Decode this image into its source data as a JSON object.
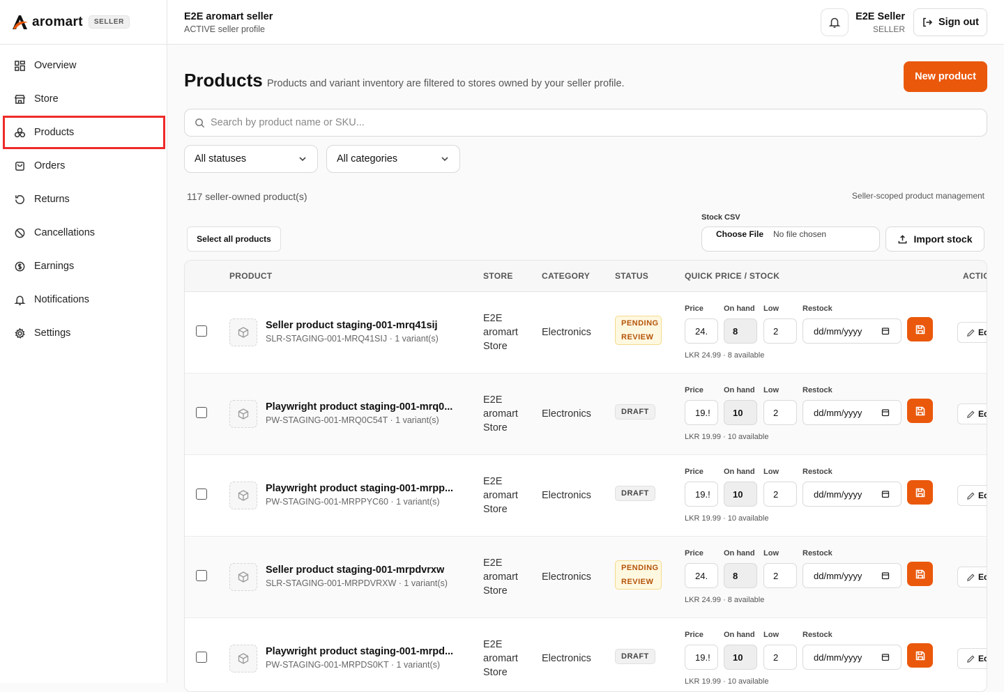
{
  "brand": {
    "name": "aromart",
    "badge": "SELLER",
    "accent": "#ea580c"
  },
  "sidebar": {
    "items": [
      {
        "label": "Overview",
        "icon": "grid-icon"
      },
      {
        "label": "Store",
        "icon": "store-icon"
      },
      {
        "label": "Products",
        "icon": "products-icon",
        "active": true
      },
      {
        "label": "Orders",
        "icon": "bag-icon"
      },
      {
        "label": "Returns",
        "icon": "return-icon"
      },
      {
        "label": "Cancellations",
        "icon": "ban-icon"
      },
      {
        "label": "Earnings",
        "icon": "dollar-icon"
      },
      {
        "label": "Notifications",
        "icon": "bell-icon"
      },
      {
        "label": "Settings",
        "icon": "gear-icon"
      }
    ]
  },
  "topbar": {
    "title": "E2E aromart seller",
    "subtitle": "ACTIVE seller profile",
    "user_name": "E2E Seller",
    "user_role": "SELLER",
    "signout_label": "Sign out"
  },
  "page": {
    "title": "Products",
    "description": "Products and variant inventory are filtered to stores owned by your seller profile.",
    "new_button": "New product"
  },
  "search": {
    "placeholder": "Search by product name or SKU..."
  },
  "filters": {
    "status": "All statuses",
    "category": "All categories"
  },
  "summary": {
    "count": "117 seller-owned product(s)",
    "scope": "Seller-scoped product management"
  },
  "csv": {
    "label": "Stock CSV",
    "choose": "Choose File",
    "no_file": "No file chosen",
    "import_label": "Import stock"
  },
  "select_all": "Select all products",
  "table": {
    "headers": {
      "product": "PRODUCT",
      "store": "STORE",
      "category": "CATEGORY",
      "status": "STATUS",
      "quick": "QUICK PRICE / STOCK",
      "actions": "ACTIO"
    },
    "field_labels": {
      "price": "Price",
      "on_hand": "On hand",
      "low": "Low",
      "restock": "Restock",
      "restock_placeholder": "dd/mm/yyyy",
      "edit": "Ed"
    },
    "rows": [
      {
        "name": "Seller product staging-001-mrq41sij",
        "sku": "SLR-STAGING-001-MRQ41SIJ · 1 variant(s)",
        "store": "E2E aromart Store",
        "category": "Electronics",
        "status": "PENDING REVIEW",
        "status_kind": "pending",
        "price": "24.",
        "on_hand": "8",
        "low": "2",
        "avail": "LKR 24.99 · 8 available"
      },
      {
        "name": "Playwright product staging-001-mrq0...",
        "sku": "PW-STAGING-001-MRQ0C54T · 1 variant(s)",
        "store": "E2E aromart Store",
        "category": "Electronics",
        "status": "DRAFT",
        "status_kind": "draft",
        "price": "19.!",
        "on_hand": "10",
        "low": "2",
        "avail": "LKR 19.99 · 10 available"
      },
      {
        "name": "Playwright product staging-001-mrpp...",
        "sku": "PW-STAGING-001-MRPPYC60 · 1 variant(s)",
        "store": "E2E aromart Store",
        "category": "Electronics",
        "status": "DRAFT",
        "status_kind": "draft",
        "price": "19.!",
        "on_hand": "10",
        "low": "2",
        "avail": "LKR 19.99 · 10 available"
      },
      {
        "name": "Seller product staging-001-mrpdvrxw",
        "sku": "SLR-STAGING-001-MRPDVRXW · 1 variant(s)",
        "store": "E2E aromart Store",
        "category": "Electronics",
        "status": "PENDING REVIEW",
        "status_kind": "pending",
        "price": "24.",
        "on_hand": "8",
        "low": "2",
        "avail": "LKR 24.99 · 8 available"
      },
      {
        "name": "Playwright product staging-001-mrpd...",
        "sku": "PW-STAGING-001-MRPDS0KT · 1 variant(s)",
        "store": "E2E aromart Store",
        "category": "Electronics",
        "status": "DRAFT",
        "status_kind": "draft",
        "price": "19.!",
        "on_hand": "10",
        "low": "2",
        "avail": "LKR 19.99 · 10 available"
      }
    ]
  }
}
